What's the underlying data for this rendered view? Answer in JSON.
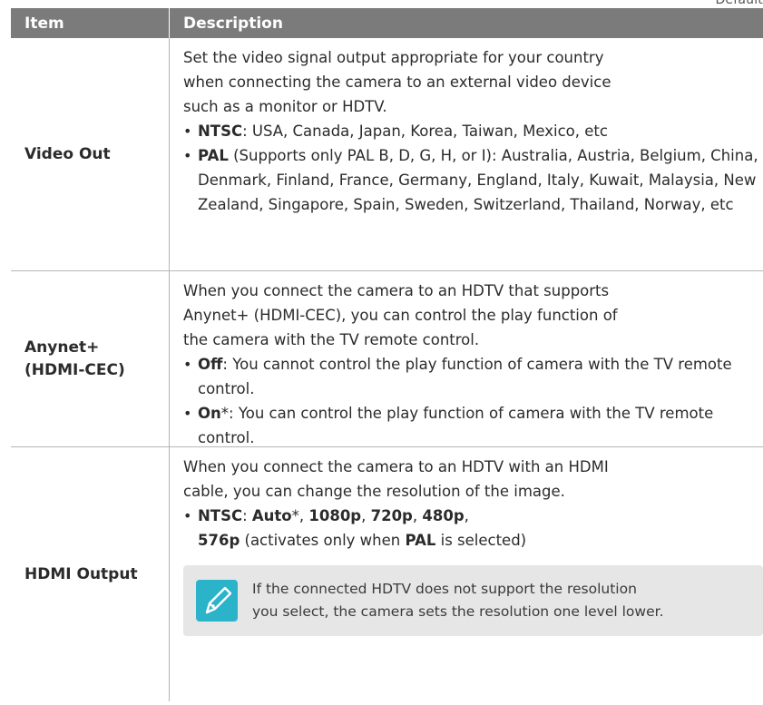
{
  "corner_text": "Default",
  "table": {
    "headers": {
      "item": "Item",
      "description": "Description"
    },
    "rows": [
      {
        "item": "Video Out",
        "intro": "Set the video signal output appropriate for your country\nwhen connecting the camera to an external video device\nsuch as a monitor or HDTV.",
        "bullets": [
          {
            "term": "NTSC",
            "text": ": USA, Canada, Japan, Korea, Taiwan, Mexico, etc"
          },
          {
            "term": "PAL",
            "text": " (Supports only PAL B, D, G, H, or I): Australia, Austria, Belgium, China, Denmark, Finland, France, Germany, England, Italy, Kuwait, Malaysia, New Zealand, Singapore, Spain, Sweden, Switzerland, Thailand, Norway, etc"
          }
        ]
      },
      {
        "item": "Anynet+\n(HDMI-CEC)",
        "intro": "When you connect the camera to an HDTV that supports\nAnynet+ (HDMI-CEC), you can control the play function of\nthe camera with the TV remote control.",
        "bullets": [
          {
            "term": "Off",
            "text": ": You cannot control the play function of camera with the TV remote control."
          },
          {
            "term": "On",
            "text": "*: You can control the play function of camera with the TV remote control."
          }
        ]
      },
      {
        "item": "HDMI Output",
        "intro": "When you connect the camera to an HDTV with an HDMI\ncable, you can change the resolution of the image.",
        "bullet": {
          "ntsc": "NTSC",
          "sep": ": ",
          "auto": "Auto",
          "auto_suffix": "*, ",
          "p1080": "1080p",
          "comma1": ", ",
          "p720": "720p",
          "comma2": ", ",
          "p480": "480p",
          "comma3": ",",
          "p576": "576p",
          "activates": " (activates only when ",
          "pal": "PAL",
          "selected": " is selected)"
        },
        "note": {
          "icon": "pencil-note-icon",
          "text": "If the connected HDTV does not support the resolution\nyou select, the camera sets the resolution one level lower."
        }
      }
    ]
  },
  "colors": {
    "header_bg": "#7b7b7b",
    "note_bg": "#e6e6e6",
    "icon_bg": "#2bb3c9"
  }
}
